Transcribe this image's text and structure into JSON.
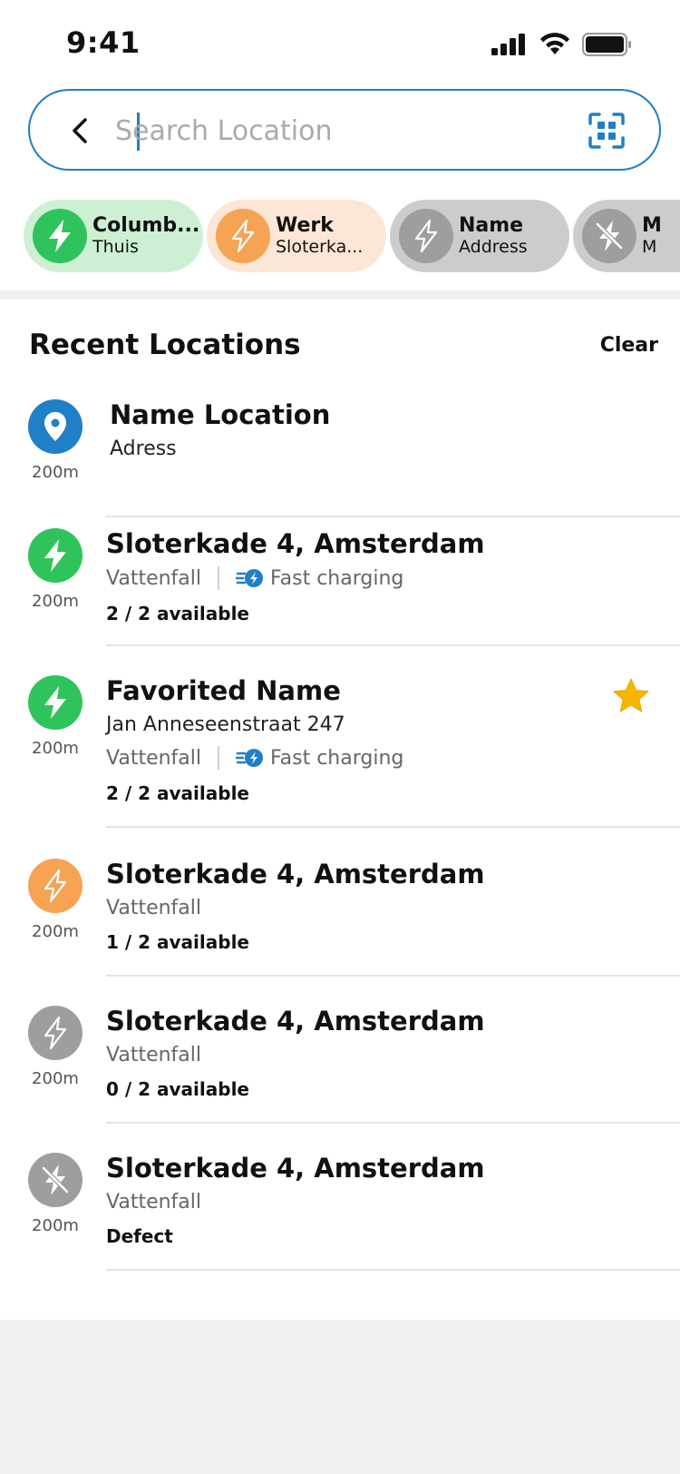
{
  "status_bar": {
    "time": "9:41",
    "signal_icon": "cellular-signal-icon",
    "wifi_icon": "wifi-icon",
    "battery_icon": "battery-icon"
  },
  "search": {
    "placeholder": "Search Location",
    "value": "",
    "back_icon": "chevron-left-icon",
    "scan_icon": "qr-scan-icon"
  },
  "chips": [
    {
      "title": "Columb...",
      "subtitle": "Thuis",
      "status": "available",
      "icon": "bolt-icon",
      "bg": "#cdf0d5",
      "icon_bg": "#2ec45b"
    },
    {
      "title": "Werk",
      "subtitle": "Sloterka...",
      "status": "partial",
      "icon": "bolt-outline-icon",
      "bg": "#fde6d5",
      "icon_bg": "#f6a353"
    },
    {
      "title": "Name",
      "subtitle": "Address",
      "status": "occupied",
      "icon": "bolt-outline-icon",
      "bg": "#cccccc",
      "icon_bg": "#9e9e9e"
    },
    {
      "title": "M",
      "subtitle": "M",
      "status": "defect",
      "icon": "bolt-crossed-icon",
      "bg": "#cccccc",
      "icon_bg": "#9e9e9e"
    }
  ],
  "recent": {
    "title": "Recent Locations",
    "clear_label": "Clear",
    "items": [
      {
        "name": "Name Location",
        "address": "Adress",
        "distance": "200m",
        "icon": "location-pin-icon"
      },
      {
        "name": "Sloterkade 4, Amsterdam",
        "operator": "Vattenfall",
        "charging": "Fast charging",
        "availability": "2 / 2  available",
        "distance": "200m",
        "icon": "bolt-icon"
      },
      {
        "name": "Favorited Name",
        "address": "Jan Anneseenstraat 247",
        "operator": "Vattenfall",
        "charging": "Fast charging",
        "availability": "2 / 2  available",
        "distance": "200m",
        "icon": "bolt-icon",
        "favorite_icon": "star-icon"
      },
      {
        "name": "Sloterkade 4, Amsterdam",
        "operator": "Vattenfall",
        "availability": "1 / 2  available",
        "distance": "200m",
        "icon": "bolt-outline-icon"
      },
      {
        "name": "Sloterkade 4, Amsterdam",
        "operator": "Vattenfall",
        "availability": "0 / 2  available",
        "distance": "200m",
        "icon": "bolt-outline-icon"
      },
      {
        "name": "Sloterkade 4, Amsterdam",
        "operator": "Vattenfall",
        "availability": "Defect",
        "distance": "200m",
        "icon": "bolt-crossed-icon"
      }
    ]
  },
  "colors": {
    "accent": "#1f7fc7",
    "available": "#2ec45b",
    "partial": "#f6a353",
    "unavailable": "#9e9e9e",
    "star": "#f7b500"
  }
}
